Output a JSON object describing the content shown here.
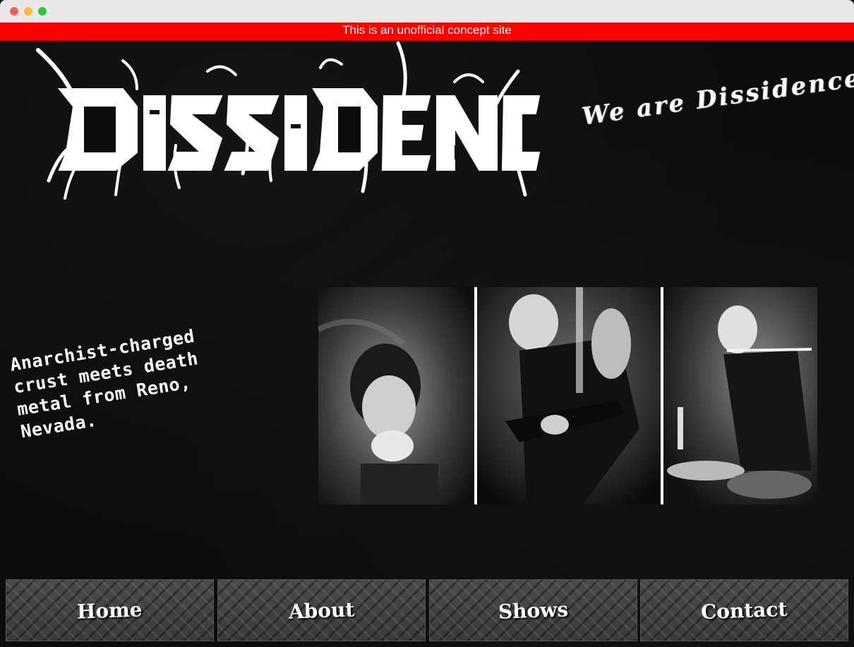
{
  "banner": {
    "text": "This is an unofficial concept site",
    "color": "#ff0000"
  },
  "logo": {
    "text": "DISSIDENCE"
  },
  "tagline": "We are Dissidence.",
  "blurb": "Anarchist-charged crust meets death metal from Reno, Nevada.",
  "nav": {
    "items": [
      {
        "label": "Home"
      },
      {
        "label": "About"
      },
      {
        "label": "Shows"
      },
      {
        "label": "Contact"
      }
    ]
  }
}
